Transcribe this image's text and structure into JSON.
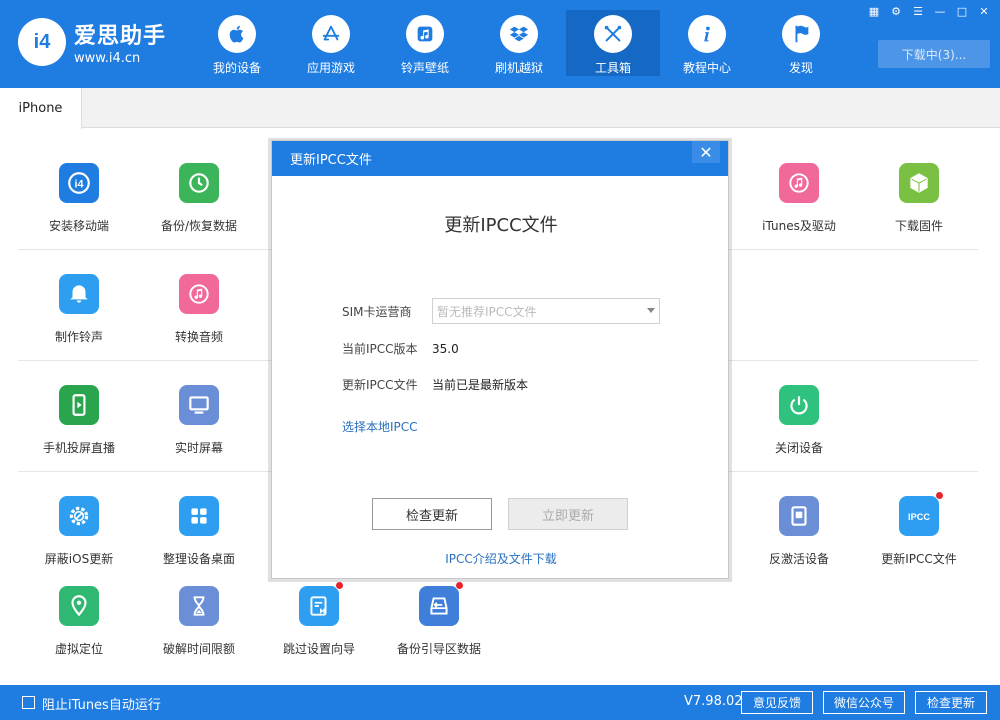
{
  "app": {
    "logo_badge": "i4",
    "logo_name": "爱思助手",
    "logo_url": "www.i4.cn",
    "brand_color": "#1f7ce0"
  },
  "nav": {
    "items": [
      {
        "label": "我的设备",
        "icon": "apple-icon"
      },
      {
        "label": "应用游戏",
        "icon": "app-store-icon"
      },
      {
        "label": "铃声壁纸",
        "icon": "music-note-icon"
      },
      {
        "label": "刷机越狱",
        "icon": "dropbox-box-icon"
      },
      {
        "label": "工具箱",
        "icon": "tools-icon",
        "active": true
      },
      {
        "label": "教程中心",
        "icon": "info-icon"
      },
      {
        "label": "发现",
        "icon": "flag-icon"
      }
    ],
    "download_label": "下载中(3)..."
  },
  "window_controls": [
    "shirt-icon",
    "gear-icon",
    "menu-icon",
    "minimize-icon",
    "maximize-icon",
    "close-icon"
  ],
  "tabs": [
    "iPhone"
  ],
  "tools": [
    {
      "label": "安装移动端",
      "icon": "i4-app-icon",
      "color": "#1f7ce0"
    },
    {
      "label": "备份/恢复数据",
      "icon": "backup-clock-icon",
      "color": "#3cb55a"
    },
    {
      "label": "iTunes及驱动",
      "icon": "itunes-icon",
      "color": "#f0699a"
    },
    {
      "label": "下载固件",
      "icon": "cube-icon",
      "color": "#7ac143"
    },
    {
      "label": "制作铃声",
      "icon": "bell-icon",
      "color": "#2e9ff0"
    },
    {
      "label": "转换音频",
      "icon": "music-icon",
      "color": "#f0699a"
    },
    {
      "label": "手机投屏直播",
      "icon": "phone-play-icon",
      "color": "#2aa54e"
    },
    {
      "label": "实时屏幕",
      "icon": "monitor-icon",
      "color": "#6b8fd6"
    },
    {
      "label": "关闭设备",
      "icon": "power-icon",
      "color": "#2ec27e"
    },
    {
      "label": "屏蔽iOS更新",
      "icon": "gear-block-icon",
      "color": "#2e9ff0"
    },
    {
      "label": "整理设备桌面",
      "icon": "grid-icon",
      "color": "#2e9ff0"
    },
    {
      "label": "反激活设备",
      "icon": "tablet-icon",
      "color": "#6b8fd6"
    },
    {
      "label": "更新IPCC文件",
      "icon": "ipcc-icon",
      "color": "#2e9ff0",
      "badge": true
    },
    {
      "label": "虚拟定位",
      "icon": "location-pin-icon",
      "color": "#2eb872"
    },
    {
      "label": "破解时间限额",
      "icon": "hourglass-icon",
      "color": "#6b8fd6"
    },
    {
      "label": "跳过设置向导",
      "icon": "skip-icon",
      "color": "#2e9ff0",
      "badge": true
    },
    {
      "label": "备份引导区数据",
      "icon": "drive-backup-icon",
      "color": "#3f7fd9",
      "badge": true
    }
  ],
  "modal": {
    "header_title": "更新IPCC文件",
    "title": "更新IPCC文件",
    "carrier_label": "SIM卡运营商",
    "carrier_placeholder": "暂无推荐IPCC文件",
    "version_label": "当前IPCC版本",
    "version_value": "35.0",
    "update_label": "更新IPCC文件",
    "update_value": "当前已是最新版本",
    "local_link": "选择本地IPCC",
    "check_button": "检查更新",
    "update_button": "立即更新",
    "intro_link": "IPCC介绍及文件下载"
  },
  "statusbar": {
    "checkbox_label": "阻止iTunes自动运行",
    "version": "V7.98.02",
    "feedback": "意见反馈",
    "wechat": "微信公众号",
    "check_update": "检查更新"
  }
}
